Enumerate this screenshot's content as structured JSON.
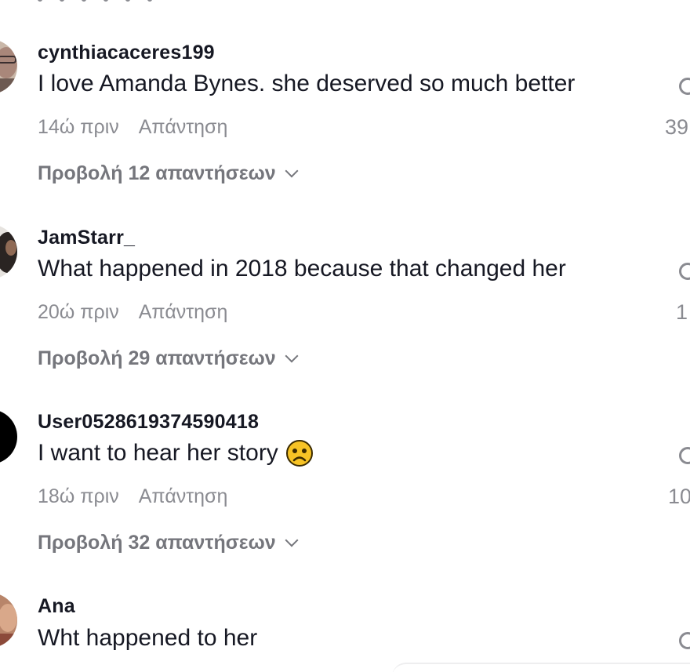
{
  "comments": [
    {
      "username": "cynthiacaceres199",
      "text": "I love Amanda Bynes. she deserved so much better",
      "time": "14ώ πριν",
      "reply_label": "Απάντηση",
      "likes": "39",
      "view_replies": "Προβολή 12 απαντήσεων",
      "emoji": ""
    },
    {
      "username": "JamStarr_",
      "text": "What happened in 2018 because that changed her",
      "time": "20ώ πριν",
      "reply_label": "Απάντηση",
      "likes": "1",
      "view_replies": "Προβολή 29 απαντήσεων",
      "emoji": ""
    },
    {
      "username": "User0528619374590418",
      "text": "I want to hear her story",
      "time": "18ώ πριν",
      "reply_label": "Απάντηση",
      "likes": "10",
      "view_replies": "Προβολή 32 απαντήσεων",
      "emoji": "sad-face-emoji"
    },
    {
      "username": "Ana",
      "text": "Wht happened to her",
      "emoji": ""
    }
  ],
  "icons": {
    "like": "heart-outline-icon",
    "expand": "chevron-down-icon"
  },
  "colors": {
    "primary_text": "#161823",
    "secondary_text": "#8a8b91",
    "replies_text": "#75767c"
  }
}
